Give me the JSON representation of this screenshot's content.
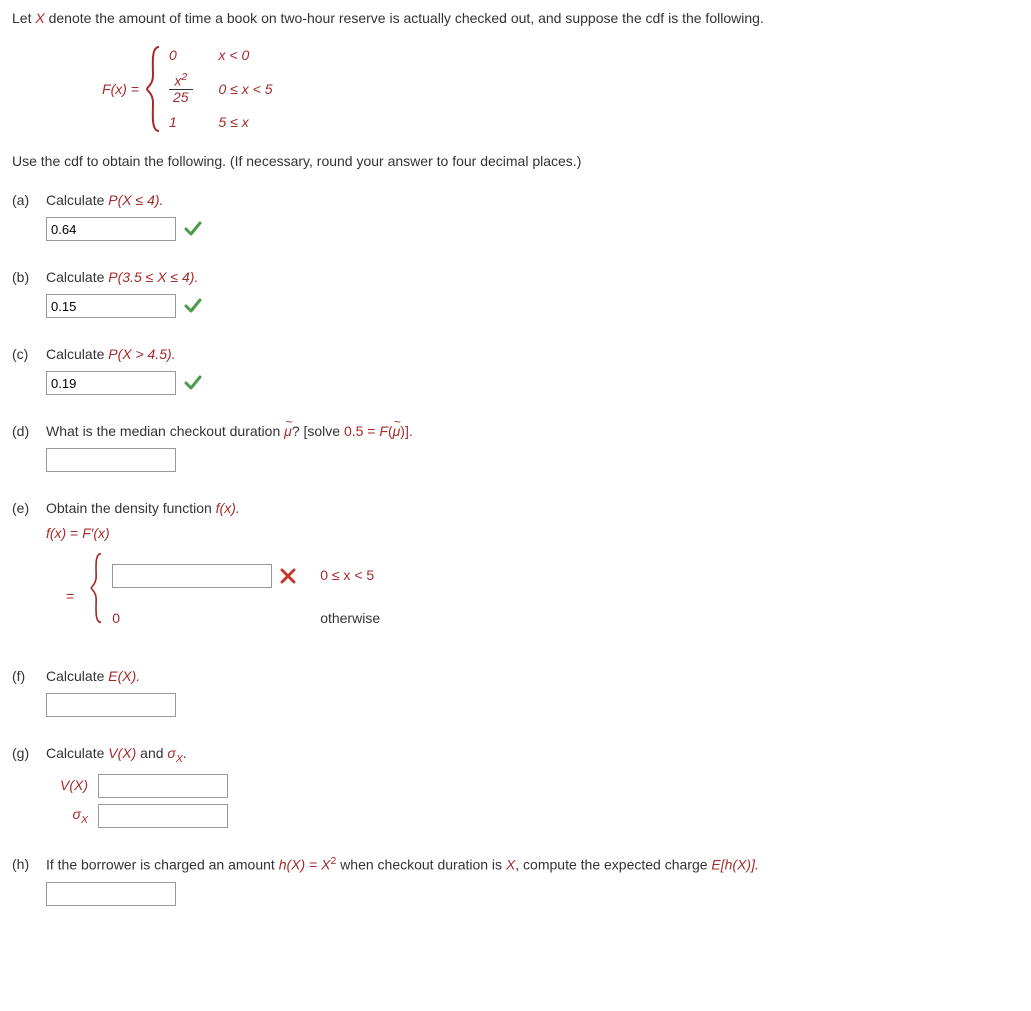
{
  "intro": {
    "prefix": "Let ",
    "var": "X",
    "rest": " denote the amount of time a book on two-hour reserve is actually checked out, and suppose the cdf is the following."
  },
  "formula": {
    "lhs_pre": "F",
    "lhs_arg": "x",
    "row1_val": "0",
    "row1_cond_pre": "x",
    "row1_cond_rest": " < 0",
    "row2_num_base": "x",
    "row2_num_exp": "2",
    "row2_den": "25",
    "row2_cond": "0 ≤ x < 5",
    "row3_val": "1",
    "row3_cond": "5 ≤ x"
  },
  "instruction": "Use the cdf to obtain the following. (If necessary, round your answer to four decimal places.)",
  "a": {
    "label": "(a)",
    "q_pre": "Calculate ",
    "q_math": "P(X ≤ 4).",
    "value": "0.64",
    "status": "correct"
  },
  "b": {
    "label": "(b)",
    "q_pre": "Calculate ",
    "q_math": "P(3.5 ≤ X ≤ 4).",
    "value": "0.15",
    "status": "correct"
  },
  "c": {
    "label": "(c)",
    "q_pre": "Calculate ",
    "q_math": "P(X > 4.5).",
    "value": "0.19",
    "status": "correct"
  },
  "d": {
    "label": "(d)",
    "q_pre": "What is the median checkout duration ",
    "mu": "μ",
    "q_mid": "? [solve ",
    "eq_lhs": "0.5 = ",
    "F": "F",
    "q_end": ")].",
    "value": ""
  },
  "e": {
    "label": "(e)",
    "q_pre": "Obtain the density function ",
    "fx": "f(x).",
    "line2_lhs": "f(x)",
    "line2_eq": " = ",
    "line2_rhs": "F′(x)",
    "eq": "=",
    "cond1": "0 ≤ x < 5",
    "zero": "0",
    "cond2": "otherwise",
    "value": "",
    "status": "incorrect"
  },
  "f": {
    "label": "(f)",
    "q_pre": "Calculate ",
    "q_math": "E(X).",
    "value": ""
  },
  "g": {
    "label": "(g)",
    "q_pre": "Calculate ",
    "VX": "V(X)",
    "mid": " and ",
    "sigma": "σ",
    "sub": "X",
    "end": ".",
    "vx_label": "V(X)",
    "sx_label_sigma": "σ",
    "sx_label_sub": "X",
    "vx_value": "",
    "sx_value": ""
  },
  "h": {
    "label": "(h)",
    "q_pre": "If the borrower is charged an amount ",
    "hx": "h(X) = X",
    "exp": "2",
    "mid": " when checkout duration is ",
    "X": "X",
    "rest": ", compute the expected charge ",
    "EhX": "E[h(X)].",
    "value": ""
  }
}
